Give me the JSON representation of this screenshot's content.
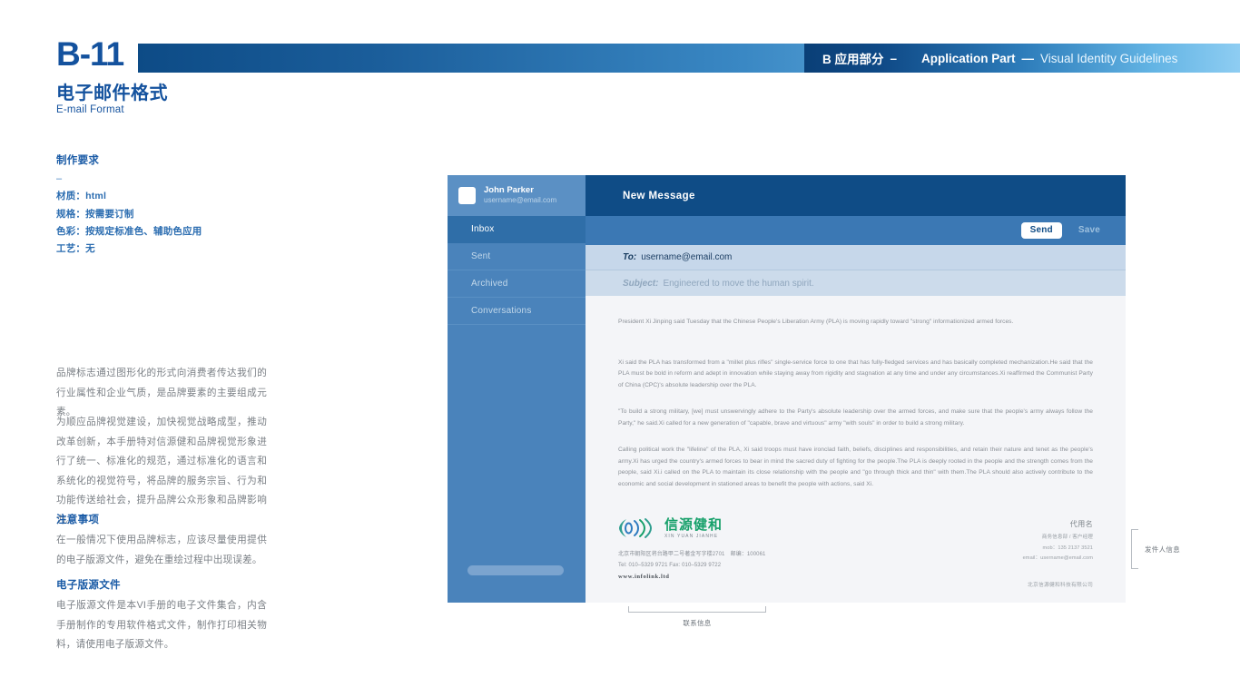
{
  "header": {
    "code": "B-11",
    "band_label_cn": "B 应用部分",
    "band_dash": "–",
    "band_label_en": "Application Part",
    "band_sep": "—",
    "band_sub": "Visual Identity Guidelines",
    "title_cn": "电子邮件格式",
    "title_en": "E-mail Format",
    "accent_dark": "#0f4c86",
    "accent_light": "#8ecdf2",
    "brand_blue": "#14529e"
  },
  "left": {
    "spec": {
      "title": "制作要求",
      "dash": "–",
      "lines": [
        "材质：html",
        "规格：按需要订制",
        "色彩：按规定标准色、辅助色应用",
        "工艺：无"
      ]
    },
    "intro": {
      "p1": "品牌标志通过图形化的形式向消费者传达我们的行业属性和企业气质，是品牌要素的主要组成元素。",
      "p2": "为顺应品牌视觉建设，加快视觉战略成型，推动改革创新，本手册特对信源健和品牌视觉形象进行了统一、标准化的规范，通过标准化的语言和系统化的视觉符号，将品牌的服务宗旨、行为和功能传送给社会，提升品牌公众形象和品牌影响力。"
    },
    "notice": {
      "heading": "注意事项",
      "body": "在一般情况下使用品牌标志，应该尽量使用提供的电子版源文件，避免在重绘过程中出现误差。"
    },
    "source": {
      "heading": "电子版源文件",
      "body": "电子版源文件是本VI手册的电子文件集合，内含手册制作的专用软件格式文件，制作打印相关物料，请使用电子版源文件。"
    }
  },
  "email": {
    "user": {
      "name": "John Parker",
      "email": "username@email.com"
    },
    "nav": [
      {
        "label": "Inbox",
        "active": true
      },
      {
        "label": "Sent",
        "active": false
      },
      {
        "label": "Archived",
        "active": false
      },
      {
        "label": "Conversations",
        "active": false
      }
    ],
    "compose": {
      "title": "New Message",
      "send_label": "Send",
      "save_label": "Save",
      "to_label": "To:",
      "to_value": "username@email.com",
      "subject_label": "Subject:",
      "subject_value": "Engineered to move the human spirit."
    },
    "body": {
      "intro": "President Xi Jinping said Tuesday that the Chinese People's Liberation Army (PLA) is moving rapidly toward \"strong\" informationized armed forces.",
      "p1": "Xi said the PLA has transformed from a \"millet plus rifles\" single-service force to one that has fully-fledged services and has basically completed mechanization.He said that the PLA must be bold in reform and adept in innovation while staying away from rigidity and stagnation at any time and under any circumstances.Xi reaffirmed the Communist Party of China (CPC)'s absolute leadership over the PLA.",
      "p2": "\"To build a strong military, [we] must unswervingly adhere to the Party's absolute leadership over the armed forces, and make sure that the people's army always follow the Party,\" he said.Xi called for a new generation of \"capable, brave and virtuous\" army \"with souls\" in order to build a strong military.",
      "p3": "Calling political work the \"lifeline\" of the PLA, Xi said troops must have ironclad faith, beliefs, disciplines and responsibilities, and retain their nature and tenet as the people's army.Xi has urged the country's armed forces to bear in mind the sacred duty of fighting for the people.The PLA is deeply rooted in the people and the strength comes from the people, said Xi.i called on the PLA to maintain its close relationship with the people and \"go through thick and thin\" with them.The PLA should also actively contribute to the economic and social development in stationed areas to benefit the people with actions, said Xi."
    },
    "signature": {
      "logo_cn": "信源健和",
      "logo_en": "XIN YUAN JIANHE",
      "address": "北京市朝阳区将台路甲二号著金写字楼2701　邮编：100061",
      "telfax": "Tel: 010–5329 9721  Fax: 010–5329 9722",
      "url": "www.infolink.ltd",
      "name": "代用名",
      "dept": "商务信息部 / 客户经理",
      "mobile": "mob：135 2137 3521",
      "mail": "email：username@email.com",
      "company": "北京信源健和科技有限公司",
      "logo_green": "#16a06a",
      "logo_teal": "#2f9e8f",
      "logo_blue": "#2e7bbf"
    }
  },
  "annotations": {
    "sender_info": "发件人信息",
    "contact_info": "联系信息"
  }
}
